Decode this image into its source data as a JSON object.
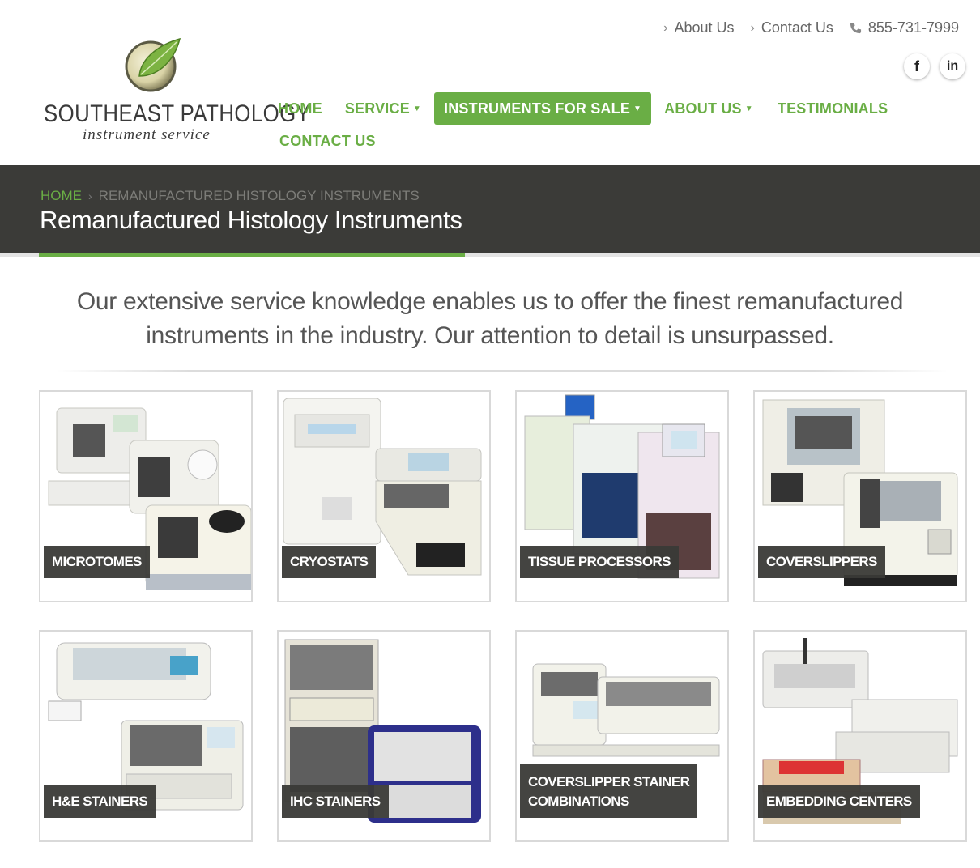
{
  "brand": {
    "title": "SOUTHEAST PATHOLOGY",
    "subtitle": "instrument service",
    "accent_color": "#6aae45"
  },
  "toplinks": {
    "about": "About Us",
    "contact": "Contact Us",
    "phone": "855-731-7999"
  },
  "social": {
    "facebook": "f",
    "linkedin": "in"
  },
  "nav": {
    "home": "HOME",
    "service": "SERVICE",
    "instruments": "INSTRUMENTS FOR SALE",
    "about": "ABOUT US",
    "testimonials": "TESTIMONIALS",
    "contact": "CONTACT US"
  },
  "banner": {
    "crumb_home": "HOME",
    "crumb_current": "REMANUFACTURED HISTOLOGY INSTRUMENTS",
    "title": "Remanufactured Histology Instruments",
    "background": "#3b3b38"
  },
  "intro": {
    "line1": "Our extensive service knowledge enables us to offer the finest remanufactured",
    "line2": "instruments in the industry. Our attention to detail is unsurpassed."
  },
  "products": [
    {
      "label": "MICROTOMES"
    },
    {
      "label": "CRYOSTATS"
    },
    {
      "label": "TISSUE PROCESSORS"
    },
    {
      "label": "COVERSLIPPERS"
    },
    {
      "label": "H&E STAINERS"
    },
    {
      "label": "IHC STAINERS"
    },
    {
      "label_line1": "COVERSLIPPER STAINER",
      "label_line2": "COMBINATIONS"
    },
    {
      "label": "EMBEDDING CENTERS"
    }
  ]
}
